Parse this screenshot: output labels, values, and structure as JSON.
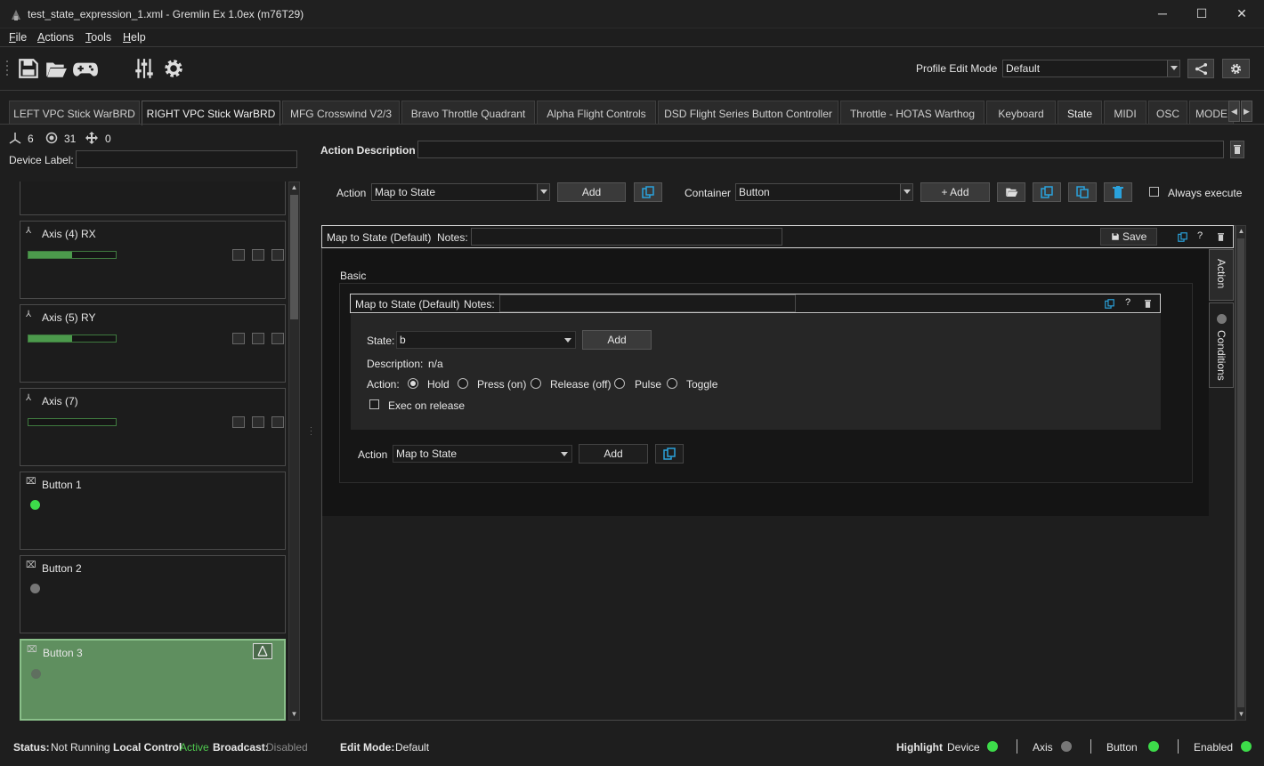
{
  "window": {
    "title": "test_state_expression_1.xml - Gremlin Ex 1.0ex (m76T29)",
    "minimize": "─",
    "maximize": "☐",
    "close": "✕"
  },
  "menu": [
    {
      "label": "File",
      "accel": "F",
      "rest": "ile"
    },
    {
      "label": "Actions",
      "accel": "A",
      "rest": "ctions"
    },
    {
      "label": "Tools",
      "accel": "T",
      "rest": "ools"
    },
    {
      "label": "Help",
      "accel": "H",
      "rest": "elp"
    }
  ],
  "toolbar": {
    "icons": [
      "save-icon",
      "open-folder-icon",
      "gamepad-icon",
      "sliders-icon",
      "gear-icon"
    ],
    "profile_edit_mode_label": "Profile Edit Mode",
    "profile_edit_mode_value": "Default"
  },
  "tabs": [
    "LEFT VPC Stick WarBRD",
    "RIGHT VPC Stick WarBRD",
    "MFG Crosswind V2/3",
    "Bravo Throttle Quadrant",
    "Alpha Flight Controls",
    "DSD Flight Series Button Controller",
    "Throttle - HOTAS Warthog",
    "Keyboard",
    "State",
    "MIDI",
    "OSC",
    "MODE"
  ],
  "device": {
    "axis_count": "6",
    "button_count": "31",
    "hat_count": "0",
    "label_caption": "Device Label:",
    "label_value": ""
  },
  "inputs": [
    {
      "type": "axis",
      "name": "Axis (4) RX",
      "level": 0.5
    },
    {
      "type": "axis",
      "name": "Axis (5) RY",
      "level": 0.5
    },
    {
      "type": "axis",
      "name": "Axis (7)",
      "level": 0.0
    },
    {
      "type": "button",
      "name": "Button 1",
      "state": "on"
    },
    {
      "type": "button",
      "name": "Button 2",
      "state": "off"
    },
    {
      "type": "button",
      "name": "Button 3",
      "state": "off",
      "selected": true
    }
  ],
  "action_description": {
    "label": "Action Description",
    "value": ""
  },
  "action_row": {
    "action_label": "Action",
    "action_value": "Map to State",
    "add_label": "Add",
    "container_label": "Container",
    "container_value": "Button",
    "container_add_label": "+ Add",
    "always_execute_label": "Always execute"
  },
  "container_header": {
    "title": "Map to State (Default)",
    "notes_label": "Notes:",
    "save_label": "Save",
    "help": "?"
  },
  "basic_label": "Basic",
  "inner_header": {
    "title": "Map to State (Default)",
    "notes_label": "Notes:",
    "help": "?"
  },
  "state_form": {
    "state_label": "State:",
    "state_value": "b",
    "add_label": "Add",
    "description_label": "Description:",
    "description_value": "n/a",
    "action_label": "Action:",
    "options": [
      "Hold",
      "Press (on)",
      "Release (off)",
      "Pulse",
      "Toggle"
    ],
    "selected_option": "Hold",
    "exec_on_release_label": "Exec on release"
  },
  "bottom_action": {
    "label": "Action",
    "value": "Map to State",
    "add_label": "Add"
  },
  "side_tabs": {
    "action": "Action",
    "conditions": "Conditions"
  },
  "status": {
    "status_label": "Status:",
    "status_value": "Not Running",
    "local_control_label": "Local Control",
    "local_control_value": "Active",
    "broadcast_label": "Broadcast:",
    "broadcast_value": "Disabled",
    "edit_mode_label": "Edit Mode:",
    "edit_mode_value": "Default",
    "highlight_label": "Highlight",
    "device_label": "Device",
    "axis_label": "Axis",
    "button_label": "Button",
    "enabled_label": "Enabled"
  },
  "colors": {
    "accent": "#2aa2dc",
    "led_on": "#3ddc4a",
    "led_off": "#777777",
    "active_text": "#4fc94f",
    "disabled_text": "#8a8a8a",
    "selected_card": "#5f8f5f"
  }
}
